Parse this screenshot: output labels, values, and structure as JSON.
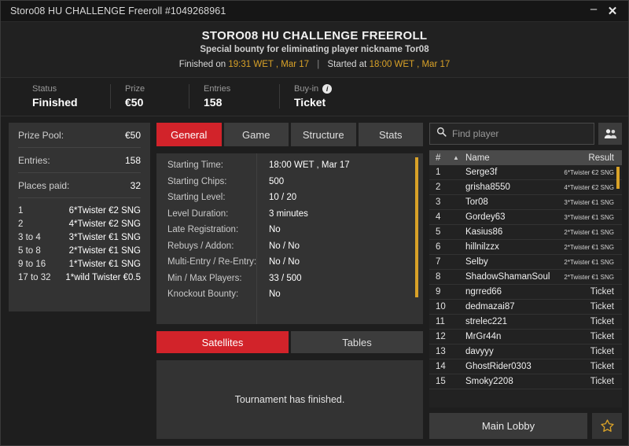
{
  "window": {
    "title": "Storo08 HU CHALLENGE Freeroll #1049268961",
    "minimize_label": "–",
    "close_label": "✕"
  },
  "header": {
    "title": "STORO08 HU CHALLENGE FREEROLL",
    "subtitle": "Special bounty for eliminating player nickname Tor08",
    "finished_label": "Finished on",
    "finished_value": "19:31 WET , Mar 17",
    "separator": "|",
    "started_label": "Started at",
    "started_value": "18:00 WET , Mar 17"
  },
  "status_strip": [
    {
      "label": "Status",
      "value": "Finished",
      "info": false
    },
    {
      "label": "Prize",
      "value": "€50",
      "info": false
    },
    {
      "label": "Entries",
      "value": "158",
      "info": false
    },
    {
      "label": "Buy-in",
      "value": "Ticket",
      "info": true,
      "info_glyph": "i"
    }
  ],
  "prize_panel": {
    "rows": [
      {
        "key": "Prize Pool:",
        "value": "€50"
      },
      {
        "key": "Entries:",
        "value": "158"
      },
      {
        "key": "Places paid:",
        "value": "32"
      }
    ],
    "payouts": [
      {
        "place": "1",
        "reward": "6*Twister €2 SNG"
      },
      {
        "place": "2",
        "reward": "4*Twister €2 SNG"
      },
      {
        "place": "3  to  4",
        "reward": "3*Twister €1 SNG"
      },
      {
        "place": "5  to  8",
        "reward": "2*Twister €1 SNG"
      },
      {
        "place": "9  to  16",
        "reward": "1*Twister €1 SNG"
      },
      {
        "place": "17  to  32",
        "reward": "1*wild Twister €0.5"
      }
    ]
  },
  "tabs": [
    {
      "label": "General",
      "active": true
    },
    {
      "label": "Game",
      "active": false
    },
    {
      "label": "Structure",
      "active": false
    },
    {
      "label": "Stats",
      "active": false
    }
  ],
  "general_details": [
    {
      "key": "Starting Time:",
      "value": "18:00 WET , Mar 17"
    },
    {
      "key": "Starting Chips:",
      "value": "500"
    },
    {
      "key": "Starting Level:",
      "value": "10 / 20"
    },
    {
      "key": "Level Duration:",
      "value": "3 minutes"
    },
    {
      "key": "Late Registration:",
      "value": "No"
    },
    {
      "key": "Rebuys / Addon:",
      "value": "No / No"
    },
    {
      "key": "Multi-Entry / Re-Entry:",
      "value": "No / No"
    },
    {
      "key": "Min / Max Players:",
      "value": "33 / 500"
    },
    {
      "key": "Knockout Bounty:",
      "value": "No"
    }
  ],
  "sat_tabs": [
    {
      "label": "Satellites",
      "active": true
    },
    {
      "label": "Tables",
      "active": false
    }
  ],
  "sat_message": "Tournament has finished.",
  "search": {
    "placeholder": "Find player",
    "value": "",
    "icon": "search-icon",
    "people_icon": "people-icon"
  },
  "player_list": {
    "columns": {
      "num": "#",
      "sort": "▲",
      "name": "Name",
      "result": "Result"
    },
    "rows": [
      {
        "num": "1",
        "name": "Serge3f",
        "result": "6*Twister €2 SNG",
        "small": true
      },
      {
        "num": "2",
        "name": "grisha8550",
        "result": "4*Twister €2 SNG",
        "small": true
      },
      {
        "num": "3",
        "name": "Tor08",
        "result": "3*Twister €1 SNG",
        "small": true
      },
      {
        "num": "4",
        "name": "Gordey63",
        "result": "3*Twister €1 SNG",
        "small": true
      },
      {
        "num": "5",
        "name": "Kasius86",
        "result": "2*Twister €1 SNG",
        "small": true
      },
      {
        "num": "6",
        "name": "hillnilzzx",
        "result": "2*Twister €1 SNG",
        "small": true
      },
      {
        "num": "7",
        "name": "Selby",
        "result": "2*Twister €1 SNG",
        "small": true
      },
      {
        "num": "8",
        "name": "ShadowShamanSoul",
        "result": "2*Twister €1 SNG",
        "small": true
      },
      {
        "num": "9",
        "name": "ngrred66",
        "result": "Ticket",
        "small": false
      },
      {
        "num": "10",
        "name": "dedmazai87",
        "result": "Ticket",
        "small": false
      },
      {
        "num": "11",
        "name": "strelec221",
        "result": "Ticket",
        "small": false
      },
      {
        "num": "12",
        "name": "MrGr44n",
        "result": "Ticket",
        "small": false
      },
      {
        "num": "13",
        "name": "davyyy",
        "result": "Ticket",
        "small": false
      },
      {
        "num": "14",
        "name": "GhostRider0303",
        "result": "Ticket",
        "small": false
      },
      {
        "num": "15",
        "name": "Smoky2208",
        "result": "Ticket",
        "small": false
      }
    ]
  },
  "footer": {
    "main_lobby": "Main Lobby",
    "favorite_icon": "star-icon"
  },
  "colors": {
    "accent_red": "#d2232a",
    "accent_gold": "#d9a228",
    "panel": "#333333",
    "background": "#1e1e1e",
    "list_background": "#222222"
  }
}
